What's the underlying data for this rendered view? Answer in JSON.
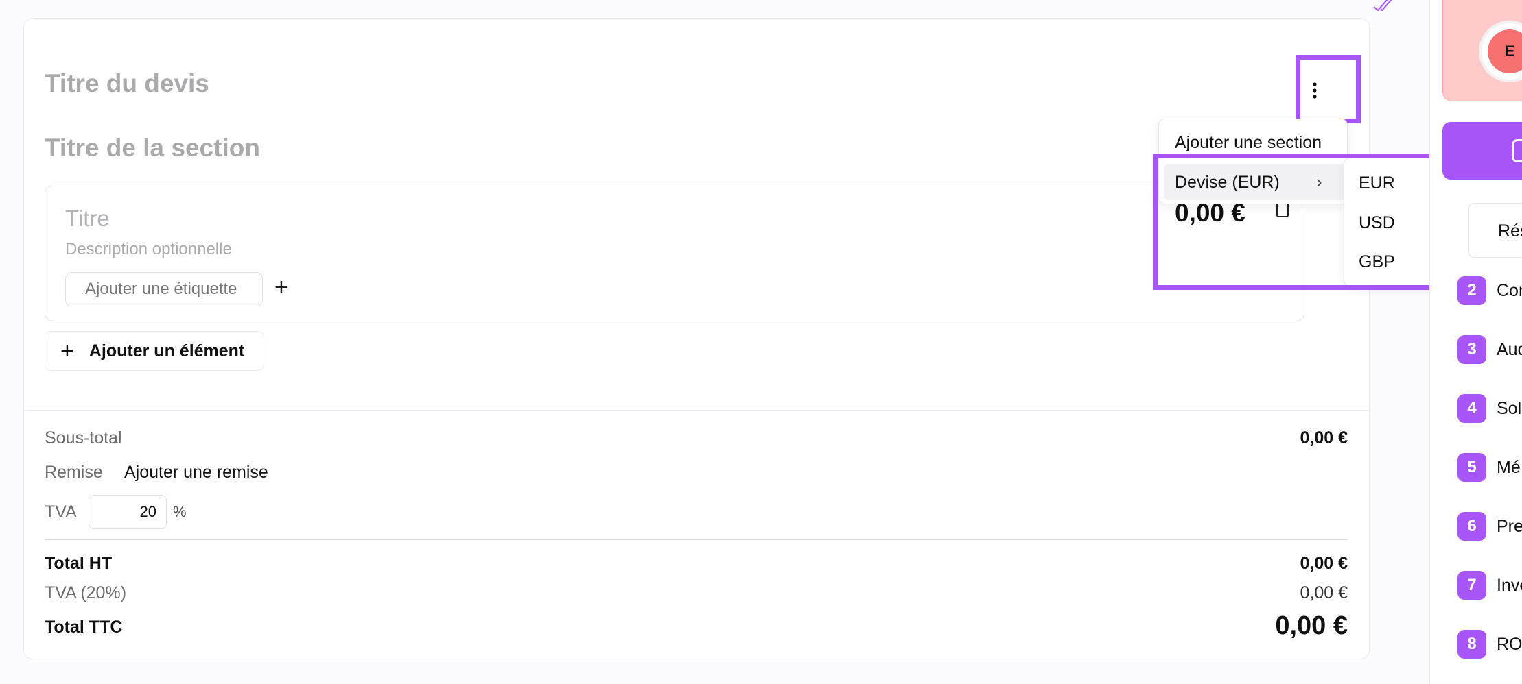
{
  "quote": {
    "title_placeholder": "Titre du devis",
    "section_title_placeholder": "Titre de la section"
  },
  "item": {
    "title_placeholder": "Titre",
    "description_placeholder": "Description optionnelle",
    "tag_placeholder": "Ajouter une étiquette",
    "add_element_label": "Ajouter un élément",
    "price_peek": "0,00 €"
  },
  "totals": {
    "subtotal_label": "Sous-total",
    "subtotal_value": "0,00 €",
    "discount_label": "Remise",
    "add_discount_label": "Ajouter une remise",
    "vat_label": "TVA",
    "vat_rate": "20",
    "vat_unit": "%",
    "ht_label": "Total HT",
    "ht_value": "0,00 €",
    "vat_line_label": "TVA (20%)",
    "vat_line_value": "0,00 €",
    "ttc_label": "Total TTC",
    "ttc_value": "0,00 €"
  },
  "menu": {
    "add_section": "Ajouter une section",
    "currency": "Devise (EUR)",
    "currency_options": [
      "EUR",
      "USD",
      "GBP"
    ]
  },
  "sidebar": {
    "avatar_initial": "E",
    "tab_label": "Rés",
    "steps": [
      {
        "num": "2",
        "label": "Con"
      },
      {
        "num": "3",
        "label": "Aud"
      },
      {
        "num": "4",
        "label": "Sol"
      },
      {
        "num": "5",
        "label": "Mé"
      },
      {
        "num": "6",
        "label": "Pre"
      },
      {
        "num": "7",
        "label": "Inve"
      },
      {
        "num": "8",
        "label": "RO"
      }
    ]
  },
  "colors": {
    "accent": "#a855f7",
    "profile_bg": "#fecaca",
    "avatar_bg": "#f87171"
  }
}
